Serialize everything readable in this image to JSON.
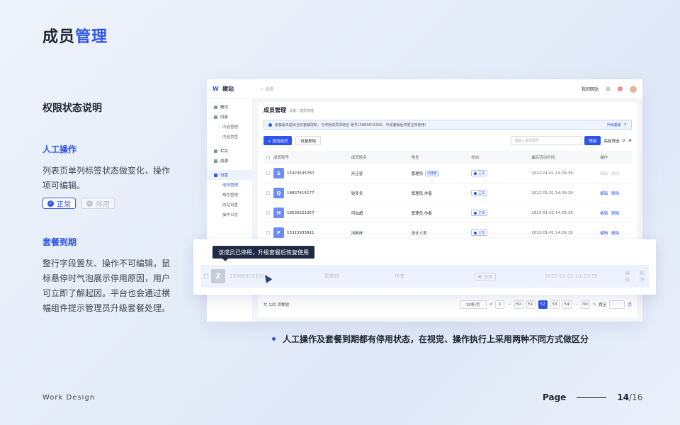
{
  "page": {
    "title_a": "成员",
    "title_b": "管理",
    "section_title": "权限状态说明",
    "manual_title": "人工操作",
    "manual_desc": "列表页单列标签状态做变化，操作项可编辑。",
    "tag_normal": "正常",
    "tag_disabled": "停用",
    "expire_title": "套餐到期",
    "expire_desc": "整行字段置灰、操作不可编辑，鼠标悬停时气泡展示停用原因，用户可立即了解起因。平台也会通过横幅组件提示管理员升级套餐处理。",
    "note": "人工操作及套餐到期都有停用状态，在视觉、操作执行上采用两种不同方式做区分",
    "footer_left": "Work Design",
    "footer_page": "Page",
    "footer_num": "14",
    "footer_total": "/16",
    "accent": "#2f54eb"
  },
  "app": {
    "logo": "建站",
    "search_placeholder": "搜索",
    "site_menu": "我的网站",
    "sidebar": [
      {
        "label": "概况",
        "type": "item"
      },
      {
        "label": "内容",
        "type": "item"
      },
      {
        "label": "内容管理",
        "type": "sub"
      },
      {
        "label": "内容类型",
        "type": "sub"
      },
      {
        "label": "栏目",
        "type": "item"
      },
      {
        "label": "资源",
        "type": "item"
      },
      {
        "label": "设置",
        "type": "item",
        "active": true
      },
      {
        "label": "成员管理",
        "type": "sub",
        "active": true
      },
      {
        "label": "角色管理",
        "type": "sub"
      },
      {
        "label": "网站设置",
        "type": "sub"
      },
      {
        "label": "操作日志",
        "type": "sub"
      }
    ],
    "content_title": "成员管理",
    "breadcrumb": "设置 / 成员管理",
    "alert_text": "套餐版本超出当前套餐限制，已停用成员周增佳 账号15889819300，升级套餐后恢复正常使用！",
    "alert_action": "升级套餐",
    "add_btn": "+ 添加成员",
    "batch_btn": "批量删除",
    "search_input": "请输入成员账号",
    "filter_btn": "筛选",
    "adv_filter": "高级筛选",
    "columns": [
      "成员账号",
      "成员姓名",
      "角色",
      "状态",
      "最后活动时间",
      "操作"
    ],
    "rows": [
      {
        "avatar": "S",
        "account": "15323535787",
        "name": "孙正容",
        "role": "管理员",
        "role_tag": "创建者",
        "status": "正常",
        "time": "2022-01-01 14:29:39",
        "edit": "编辑",
        "del": "删除",
        "disabled_ops": true
      },
      {
        "avatar": "Q",
        "account": "18837415177",
        "name": "钱多多",
        "role": "管理员,作者",
        "role_tag": "",
        "status": "正常",
        "time": "2022-01-01 14:29:39",
        "edit": "编辑",
        "del": "删除",
        "disabled_ops": false
      },
      {
        "avatar": "H",
        "account": "18539221357",
        "name": "何仙超",
        "role": "管理员,作者",
        "role_tag": "",
        "status": "正常",
        "time": "2022-01-01 14:29:39",
        "edit": "编辑",
        "del": "删除",
        "disabled_ops": false
      },
      {
        "avatar": "F",
        "account": "15315935911",
        "name": "冯新祥",
        "role": "设计人员",
        "role_tag": "",
        "status": "正常",
        "time": "2022-01-01 14:29:39",
        "edit": "编辑",
        "del": "删除",
        "disabled_ops": false
      }
    ],
    "total": "共 120 项数据",
    "page_size": "10条/页",
    "pages": [
      "<",
      "1",
      "···",
      "50",
      "51",
      "52",
      "53",
      "54",
      "···",
      "90",
      ">"
    ],
    "current_page": "52",
    "jump_label": "跳至",
    "jump_unit": "页"
  },
  "overlay": {
    "tooltip": "该成员已停用，升级套餐后恢复使用",
    "avatar": "Z",
    "account": "15889819300",
    "name": "周增佳",
    "role": "作者",
    "status": "停用",
    "time": "2022-01-01 14:29:39",
    "edit": "编辑",
    "del": "删除"
  }
}
